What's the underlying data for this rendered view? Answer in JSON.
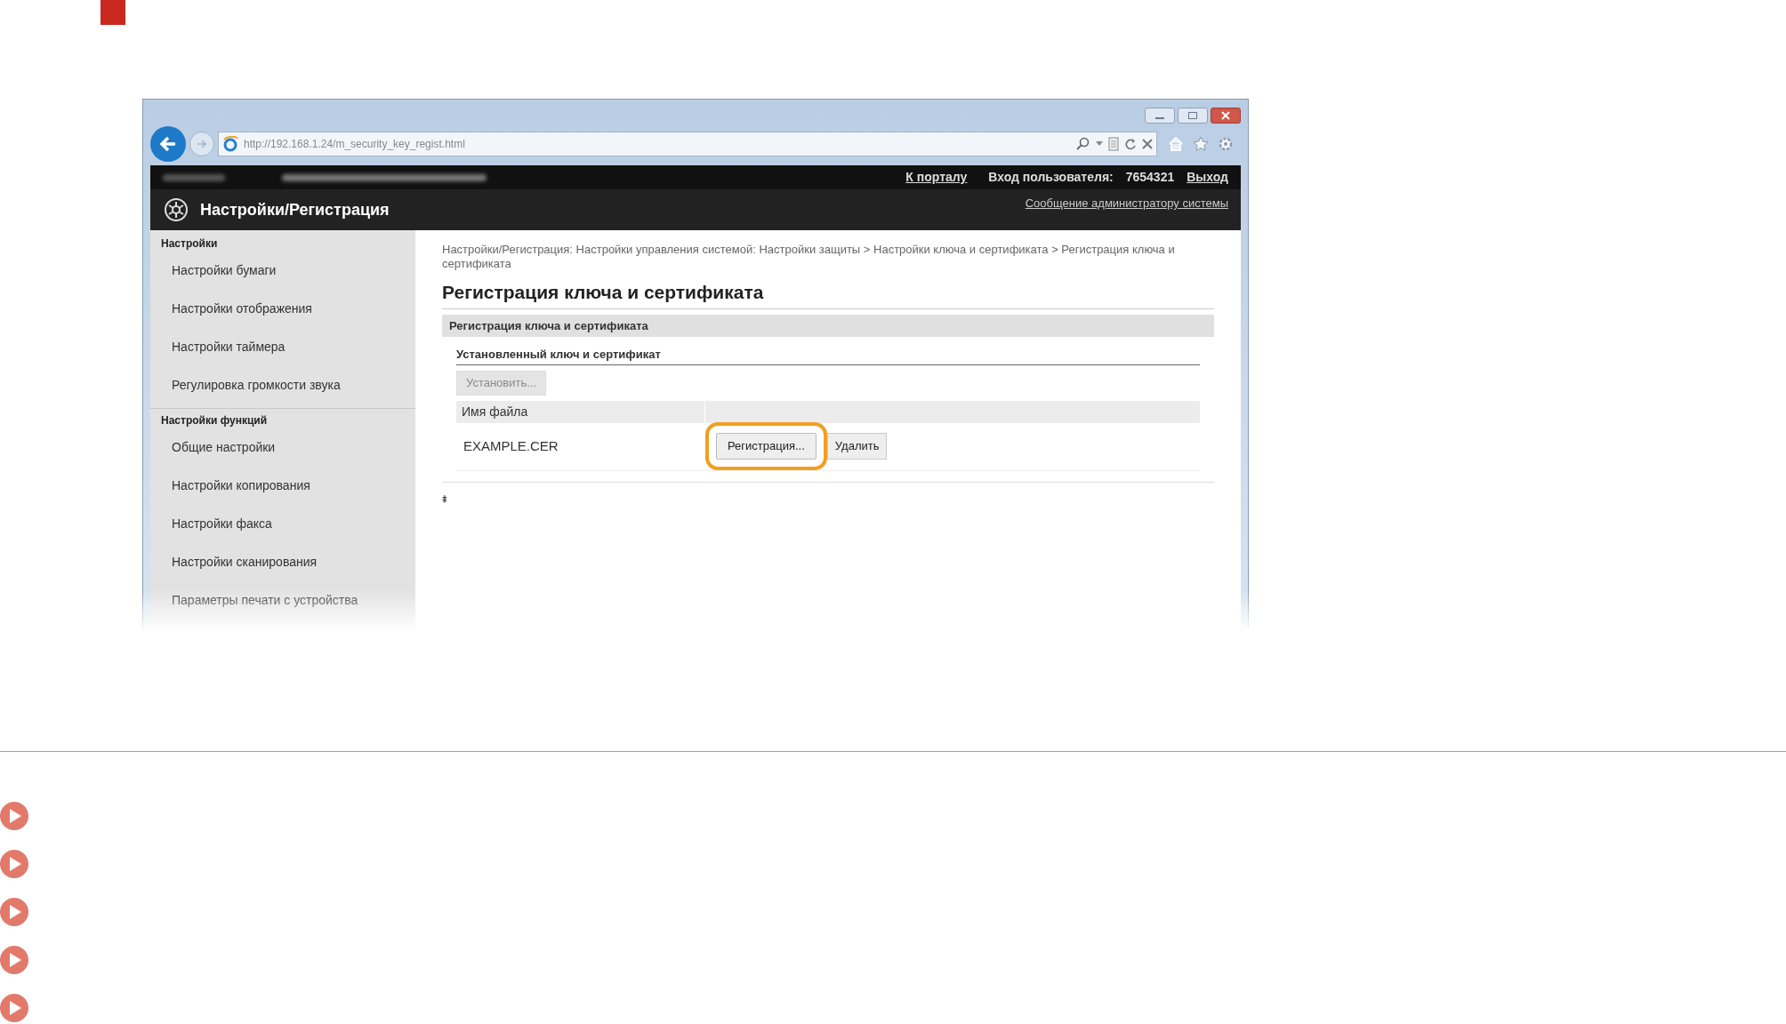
{
  "browser": {
    "url": "http://192.168.1.24/m_security_key_regist.html"
  },
  "header": {
    "portal_link": "К порталу",
    "login_label": "Вход пользователя:",
    "login_user": "7654321",
    "logout_link": "Выход",
    "app_title": "Настройки/Регистрация",
    "admin_message_link": "Сообщение администратору системы"
  },
  "sidebar": {
    "sections": [
      {
        "title": "Настройки",
        "items": [
          {
            "label": "Настройки бумаги"
          },
          {
            "label": "Настройки отображения"
          },
          {
            "label": "Настройки таймера"
          },
          {
            "label": "Регулировка громкости звука"
          }
        ]
      },
      {
        "title": "Настройки функций",
        "items": [
          {
            "label": "Общие настройки"
          },
          {
            "label": "Настройки копирования"
          },
          {
            "label": "Настройки факса"
          },
          {
            "label": "Настройки сканирования"
          },
          {
            "label": "Параметры печати с устройства"
          }
        ]
      }
    ]
  },
  "content": {
    "breadcrumb": "Настройки/Регистрация: Настройки управления системой: Настройки защиты > Настройки ключа и сертификата > Регистрация ключа и сертификата",
    "heading": "Регистрация ключа и сертификата",
    "section_title": "Регистрация ключа и сертификата",
    "subsection_title": "Установленный ключ и сертификат",
    "install_button": {
      "label": "Установить...",
      "disabled": true
    },
    "table": {
      "columns": [
        "Имя файла"
      ],
      "rows": [
        {
          "file": "EXAMPLE.CER",
          "buttons": [
            {
              "label": "Регистрация...",
              "highlighted": true
            },
            {
              "label": "Удалить",
              "highlighted": false
            }
          ]
        }
      ]
    },
    "top_link": "⯒"
  }
}
